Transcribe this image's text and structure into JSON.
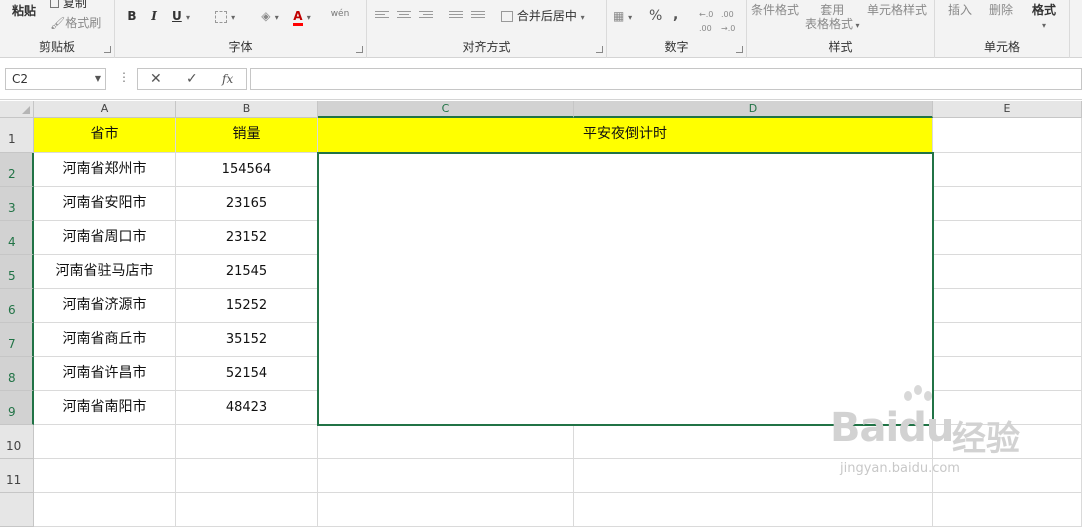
{
  "ribbon": {
    "clipboard": {
      "paste": "粘贴",
      "copy": "复制",
      "format_painter": "格式刷",
      "label": "剪贴板"
    },
    "font": {
      "bold": "B",
      "italic": "I",
      "underline": "U",
      "font_color": "A",
      "phonetic": "wén",
      "label": "字体"
    },
    "alignment": {
      "merge_center": "合并后居中",
      "label": "对齐方式"
    },
    "number": {
      "percent": "%",
      "comma": ",",
      "label": "数字"
    },
    "styles": {
      "conditional_format": "条件格式",
      "table_format_line1": "套用",
      "table_format_line2": "表格格式",
      "cell_styles": "单元格样式",
      "label": "样式"
    },
    "cells": {
      "insert": "插入",
      "delete": "删除",
      "format": "格式",
      "label": "单元格"
    }
  },
  "formula_bar": {
    "name_box": "C2",
    "cancel": "✕",
    "enter": "✓",
    "fx": "fx",
    "formula": ""
  },
  "sheet": {
    "columns": [
      "A",
      "B",
      "C",
      "D",
      "E"
    ],
    "rows": [
      "1",
      "2",
      "3",
      "4",
      "5",
      "6",
      "7",
      "8",
      "9",
      "10",
      "11"
    ],
    "header": {
      "province": "省市",
      "sales": "销量",
      "countdown": "平安夜倒计时"
    },
    "data": [
      {
        "city": "河南省郑州市",
        "sales": "154564"
      },
      {
        "city": "河南省安阳市",
        "sales": "23165"
      },
      {
        "city": "河南省周口市",
        "sales": "23152"
      },
      {
        "city": "河南省驻马店市",
        "sales": "21545"
      },
      {
        "city": "河南省济源市",
        "sales": "15252"
      },
      {
        "city": "河南省商丘市",
        "sales": "35152"
      },
      {
        "city": "河南省许昌市",
        "sales": "52154"
      },
      {
        "city": "河南省南阳市",
        "sales": "48423"
      }
    ]
  },
  "watermark": {
    "brand": "Baidu",
    "brand_suffix": "经验",
    "url": "jingyan.baidu.com"
  },
  "colors": {
    "accent": "#217346",
    "header_fill": "#ffff00",
    "font_red": "#ff0000"
  }
}
